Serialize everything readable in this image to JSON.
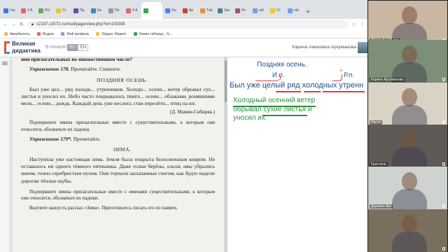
{
  "browser": {
    "tabs": [
      {
        "label": "Газ",
        "color": "#3c78d8"
      },
      {
        "label": "3 А",
        "color": "#e06666"
      },
      {
        "label": "RU",
        "color": "#6aa84f"
      },
      {
        "label": "Ст",
        "color": "#f1c232"
      },
      {
        "label": "Пр",
        "color": "#674ea7"
      },
      {
        "label": "Ка",
        "color": "#3d85c6"
      },
      {
        "label": "Пи",
        "color": "#999999"
      },
      {
        "label": "4 А",
        "color": "#e06666"
      },
      {
        "label": "",
        "color": "#34a853"
      },
      {
        "label": "Go",
        "color": "#4285f4"
      },
      {
        "label": "Ар",
        "color": "#cc4125"
      },
      {
        "label": "Тай",
        "color": "#e69138"
      },
      {
        "label": "Зах",
        "color": "#45818e"
      },
      {
        "label": "Ре",
        "color": "#a64d79"
      },
      {
        "label": "edi",
        "color": "#6d9eeb"
      },
      {
        "label": "Ст",
        "color": "#f1c232"
      },
      {
        "label": "edi",
        "color": "#6d9eeb"
      }
    ],
    "active_tab": 8,
    "new_tab": "+",
    "window_controls": {
      "minimize": "—",
      "maximize": "□",
      "close": "✕"
    },
    "url": "c2187.c3072.ru/mod/page/view.php?id=103308",
    "bookmarks": [
      {
        "label": "Авиабилеты",
        "color": "#f6b26b"
      },
      {
        "label": "Яндекс",
        "color": "#e06666"
      },
      {
        "label": "Мой профиль",
        "color": "#6fa8dc"
      },
      {
        "label": "Яндекс Маркет",
        "color": "#f1c232"
      },
      {
        "label": "Новая таблица - G...",
        "color": "#34a853"
      }
    ]
  },
  "site": {
    "logo_line1": "Великая",
    "logo_line2": "дидактика",
    "home": "В начало",
    "lang": [
      "RU",
      "EN"
    ],
    "user_name": "Карина Амиковна Арзуманова"
  },
  "book": {
    "cut_line": "ния прилагательных во множественном числе?",
    "ex178_num": "Упражнение 178.",
    "ex178_task": "Прочитайте. Спишите.",
    "title1": "ПОЗДНЯЯ ОСЕНЬ.",
    "para1": "Был уже цел... ряд холодн... утренников. Холодн... осенн... ветер обрывал сух... листья и уносил их. Небо часто покрывалось тяжёл... осенн... облаками, ронявшими мелк... осенн... дождь. Каждый день уже неслись стаи перелётн... птиц на юг.",
    "signature": "(Д. Мамин-Сибиряк.)",
    "task178": "Подчеркните имена прилагательные вместе с существительными, к которым они относятся, обозначьте их падежи.",
    "ex179_num": "Упражнение 179*.",
    "ex179_task": "Прочитайте.",
    "title2": "ЗИМА.",
    "para2": "Наступила уже настоящая зима. Земля была покрыта белоснежным ковром. Не оставалось ни одного тёмного пятнышка. Даже голые берёзы, ольхи, ивы убрались инеем, точно серебристым пухом. Они торчали засыпанные снегом, как будто надели дорогие тёплые шубы.",
    "task179a": "Подчеркните имена прилагательные вместе с именами существительными, к которым они относятся, обозначьте их падежи.",
    "task179b": "Выучите наизусть рассказ «Зима». Приготовьтесь писать его по памяти."
  },
  "whiteboard": {
    "line1": "Поздняя осень.",
    "case_left": "И.п.",
    "case_right": "Р.п.",
    "line2": "Был уже целый ряд холодных утренн",
    "line3a": "Холодный осенний ветер",
    "line3b": "обрывал сухие листья и",
    "line3c": "уносил их."
  },
  "participants": [
    {
      "name": "Давид Аю 10 лет",
      "bg": "#c9b7a3"
    },
    {
      "name": "Карина Арзуманова",
      "bg": "#7d8f76"
    },
    {
      "name": "Настя",
      "bg": "#d9d2c5"
    },
    {
      "name": "Кристина",
      "bg": "#5e5a55"
    },
    {
      "name": "Даниель 8кл",
      "bg": "#cfd3cf"
    },
    {
      "name": "",
      "bg": "#7a6e5e"
    }
  ]
}
